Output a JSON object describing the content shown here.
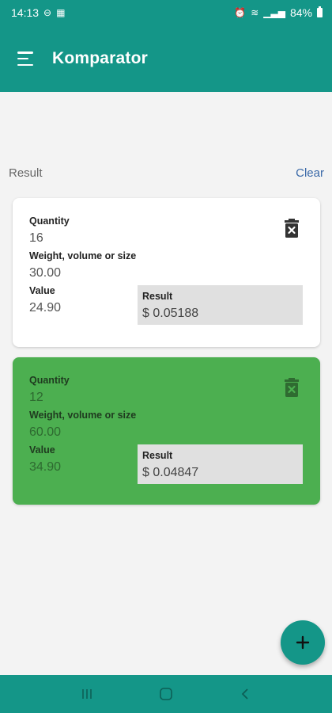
{
  "status_bar": {
    "time": "14:13",
    "left_icons": [
      "notification-icon",
      "qr-icon"
    ],
    "battery": "84%",
    "right_icons": [
      "alarm-icon",
      "wifi-icon",
      "signal-icon",
      "battery-icon"
    ]
  },
  "app_bar": {
    "title": "Komparator"
  },
  "summary": {
    "result_label": "Result",
    "clear_label": "Clear"
  },
  "cards": [
    {
      "quantity_label": "Quantity",
      "quantity": "16",
      "weight_label": "Weight, volume or size",
      "weight": "30.00",
      "value_label": "Value",
      "value": "24.90",
      "result_label": "Result",
      "result": "$ 0.05188",
      "background": "#ffffff"
    },
    {
      "quantity_label": "Quantity",
      "quantity": "12",
      "weight_label": "Weight, volume or size",
      "weight": "60.00",
      "value_label": "Value",
      "value": "34.90",
      "result_label": "Result",
      "result": "$ 0.04847",
      "background": "#4caf50"
    }
  ],
  "fab": {
    "icon": "plus-icon"
  },
  "colors": {
    "primary": "#149688",
    "highlight": "#4caf50",
    "link": "#3a69a8"
  },
  "nav_bar": {
    "icons": [
      "recent-apps-icon",
      "home-icon",
      "back-icon"
    ]
  }
}
